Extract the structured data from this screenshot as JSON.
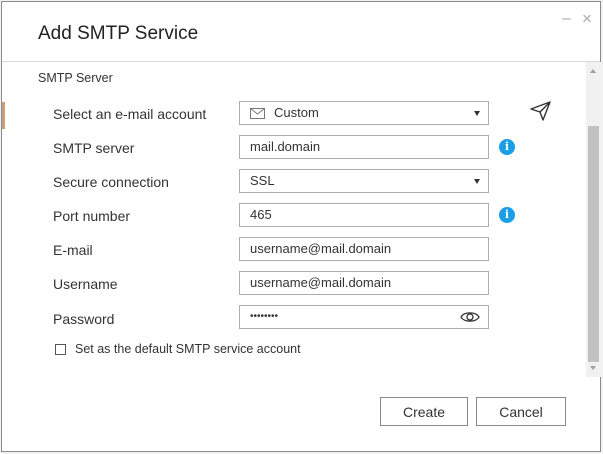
{
  "dialog": {
    "title": "Add SMTP Service",
    "section_title": "SMTP Server"
  },
  "form": {
    "account": {
      "label": "Select an e-mail account",
      "value": "Custom"
    },
    "smtp_server": {
      "label": "SMTP server",
      "value": "mail.domain"
    },
    "secure_connection": {
      "label": "Secure connection",
      "value": "SSL"
    },
    "port": {
      "label": "Port number",
      "value": "465"
    },
    "email": {
      "label": "E-mail",
      "value": "username@mail.domain"
    },
    "username": {
      "label": "Username",
      "value": "username@mail.domain"
    },
    "password": {
      "label": "Password",
      "value": "••••••••"
    },
    "default_checkbox": {
      "label": "Set as the default SMTP service account",
      "checked": false
    }
  },
  "buttons": {
    "create": "Create",
    "cancel": "Cancel"
  },
  "icons": {
    "info": "i",
    "accent": "#1a9fe6"
  }
}
